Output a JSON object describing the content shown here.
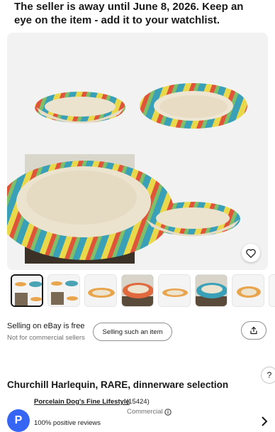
{
  "notice": {
    "text": "The seller is away until June 8, 2026. Keep an eye on the item - add it to your watchlist."
  },
  "gallery": {
    "thumbnail_count": 8,
    "selected_index": 0
  },
  "selling": {
    "title": "Selling on eBay is free",
    "subtitle": "Not for commercial sellers",
    "button_label": "Selling such an item"
  },
  "help": {
    "label": "?"
  },
  "item": {
    "title": "Churchill Harlequin, RARE, dinnerware selection"
  },
  "seller": {
    "avatar_letter": "P",
    "name": "Porcelain Dog's Fine Lifestyle",
    "count": "(15424)",
    "type": "Commercial",
    "feedback": "100% positive reviews"
  },
  "colors": {
    "accent": "#3665f3",
    "text": "#191919",
    "muted": "#707070"
  },
  "icons": [
    "heart-icon",
    "share-icon",
    "info-icon",
    "chevron-right-icon"
  ]
}
